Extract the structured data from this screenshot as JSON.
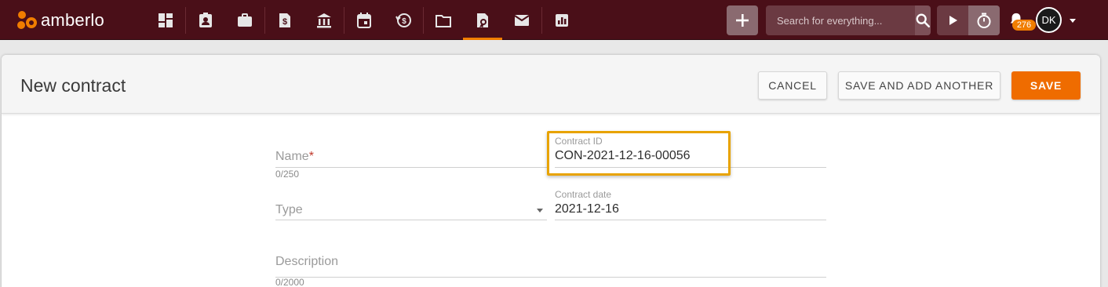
{
  "app": {
    "name": "amberlo"
  },
  "topbar": {
    "nav_icons": [
      "dashboard-icon",
      "contacts-icon",
      "matters-icon",
      "invoices-icon",
      "bank-icon",
      "calendar-icon",
      "time-entries-icon",
      "documents-icon",
      "contracts-icon",
      "mail-icon",
      "reports-icon"
    ],
    "search_placeholder": "Search for everything...",
    "notifications_count": "276",
    "user_initials": "DK"
  },
  "page": {
    "title": "New contract",
    "cancel_label": "CANCEL",
    "save_add_label": "SAVE AND ADD ANOTHER",
    "save_label": "SAVE"
  },
  "form": {
    "name_placeholder": "Name",
    "name_required_mark": "*",
    "name_counter": "0/250",
    "contract_id_label": "Contract ID",
    "contract_id_value": "CON-2021-12-16-00056",
    "type_placeholder": "Type",
    "contract_date_label": "Contract date",
    "contract_date_value": "2021-12-16",
    "description_placeholder": "Description",
    "description_counter": "0/2000"
  },
  "colors": {
    "topbar_bg": "#4a0f18",
    "accent": "#ef6c00",
    "highlight": "#e8a300"
  }
}
